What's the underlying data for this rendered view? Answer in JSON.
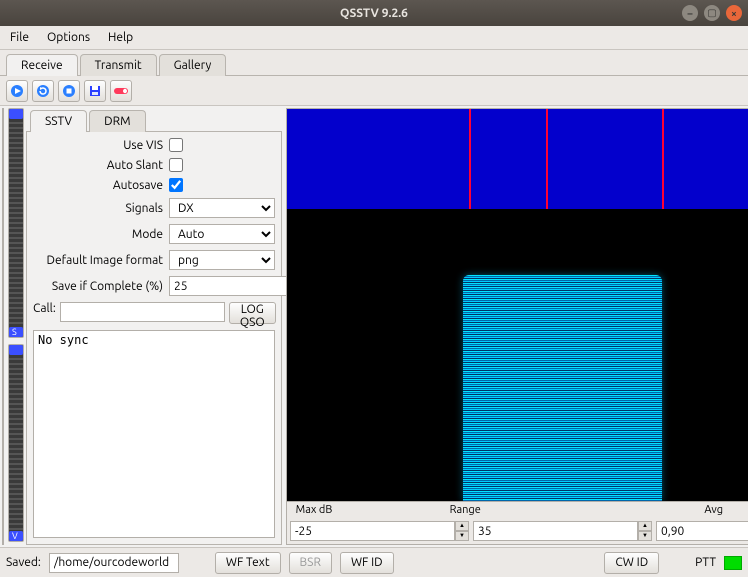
{
  "window": {
    "title": "QSSTV 9.2.6"
  },
  "menubar": {
    "file": "File",
    "options": "Options",
    "help": "Help"
  },
  "tabs": {
    "receive": "Receive",
    "transmit": "Transmit",
    "gallery": "Gallery",
    "selected": "receive"
  },
  "subtabs": {
    "sstv": "SSTV",
    "drm": "DRM",
    "selected": "sstv"
  },
  "settings": {
    "use_vis_label": "Use VIS",
    "use_vis": false,
    "auto_slant_label": "Auto Slant",
    "auto_slant": false,
    "autosave_label": "Autosave",
    "autosave": true,
    "signals_label": "Signals",
    "signals_value": "DX",
    "mode_label": "Mode",
    "mode_value": "Auto",
    "default_fmt_label": "Default Image format",
    "default_fmt_value": "png",
    "save_complete_label": "Save if Complete (%)",
    "save_complete_value": "25",
    "call_label": "Call:",
    "call_value": "",
    "log_qso_label": "LOG QSO",
    "log_text": "No sync"
  },
  "waterfall": {
    "labels": {
      "maxdb": "Max dB",
      "range": "Range",
      "avg": "Avg"
    },
    "maxdb": "-25",
    "range": "35",
    "avg": "0,90",
    "marker_positions_pct": [
      33,
      47,
      68
    ]
  },
  "statusbar": {
    "saved_label": "Saved:",
    "saved_path": "/home/ourcodeworld",
    "wf_text": "WF Text",
    "bsr": "BSR",
    "wf_id": "WF ID",
    "cw_id": "CW ID",
    "ptt_label": "PTT"
  }
}
